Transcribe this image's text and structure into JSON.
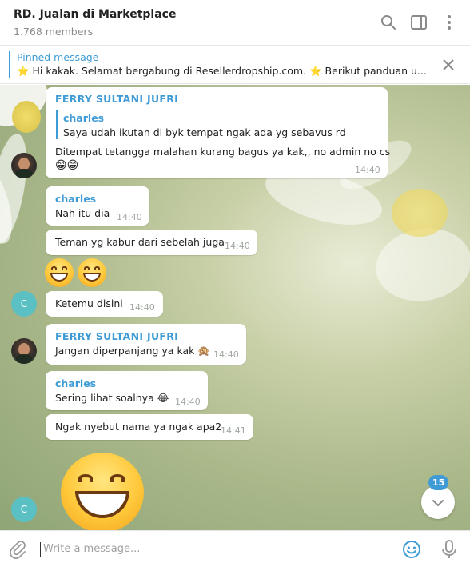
{
  "header": {
    "title": "RD. Jualan di Marketplace",
    "members": "1.768 members",
    "icons": [
      "search-icon",
      "sidebar-toggle-icon",
      "more-vert-icon"
    ]
  },
  "pinned": {
    "label": "Pinned message",
    "text": "⭐ Hi kakak. Selamat bergabung di Resellerdropship.com. ⭐   Berikut panduan u..."
  },
  "messages": [
    {
      "sender": "FERRY SULTANI JUFRI",
      "reply_sender": "charles",
      "reply_text": "Saya udah ikutan di byk tempat ngak ada yg sebavus rd",
      "text": "Ditempat tetangga malahan kurang bagus ya kak,, no admin no cs",
      "emoji_line": "😁😁",
      "time": "14:40"
    },
    {
      "sender": "charles",
      "text": "Nah itu dia",
      "time": "14:40"
    },
    {
      "text": "Teman yg kabur dari sebelah juga",
      "time": "14:40"
    },
    {
      "text": "Ketemu disini",
      "time": "14:40",
      "avatar_letter": "C"
    },
    {
      "sender": "FERRY SULTANI JUFRI",
      "text": "Jangan diperpanjang ya kak 🙊",
      "time": "14:40"
    },
    {
      "sender": "charles",
      "text": "Sering lihat soalnya 😂",
      "time": "14:40"
    },
    {
      "text": "Ngak nyebut nama ya ngak apa2",
      "time": "14:41"
    }
  ],
  "bottom_avatar_letter": "C",
  "unread_badge": "15",
  "composer": {
    "placeholder": "Write a message..."
  },
  "colors": {
    "accent": "#3e9bd5",
    "avatar_c": "#5bc0c4"
  }
}
